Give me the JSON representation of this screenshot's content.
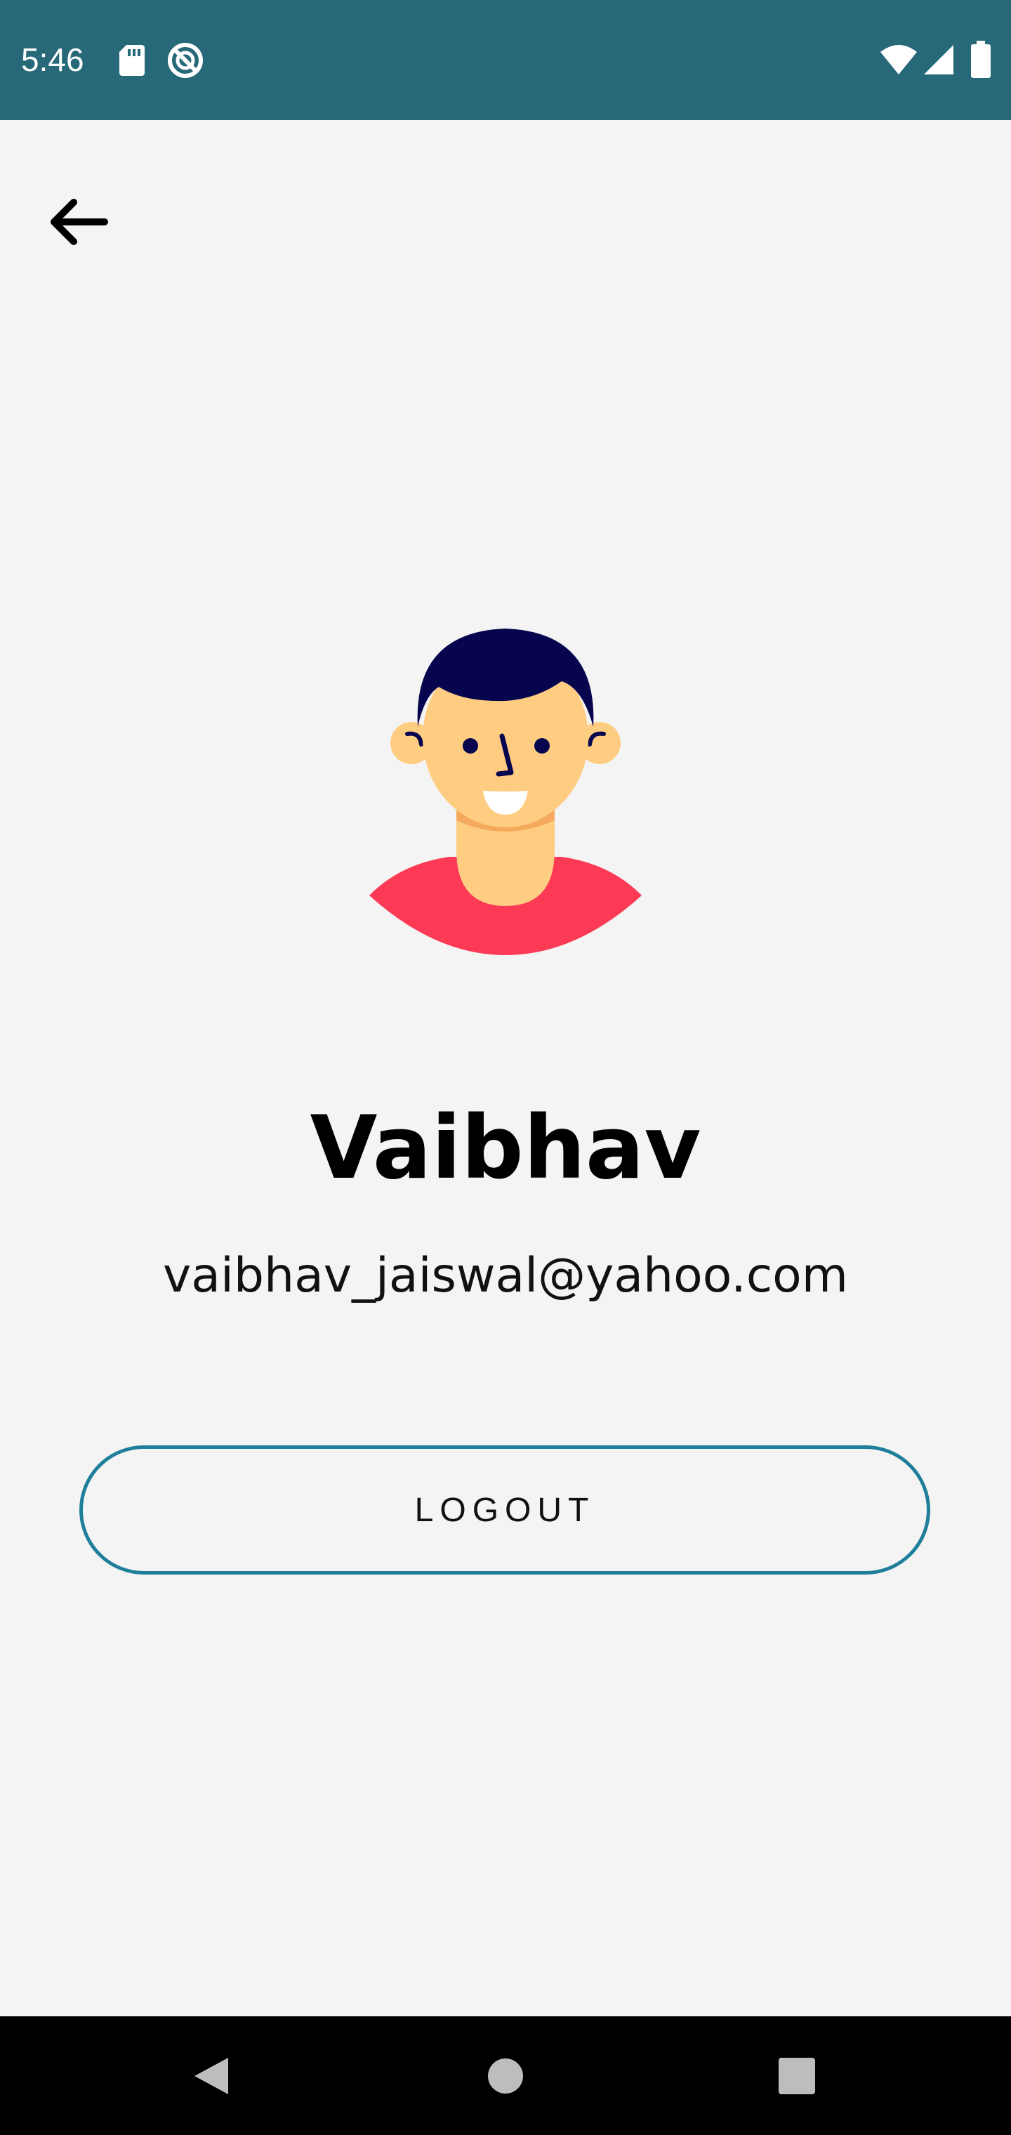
{
  "status_bar": {
    "time": "5:46",
    "icons": [
      "sd-card-icon",
      "sync-disabled-icon",
      "wifi-icon",
      "signal-icon",
      "battery-icon"
    ],
    "background": "#276879"
  },
  "header": {
    "back_icon": "arrow-left-icon"
  },
  "profile": {
    "name": "Vaibhav",
    "email": "vaibhav_jaiswal@yahoo.com",
    "avatar": "avatar-illustration"
  },
  "actions": {
    "logout_label": "LOGOUT",
    "accent_color": "#1f7f9a"
  },
  "nav_bar": {
    "icons": [
      "nav-back-icon",
      "nav-home-icon",
      "nav-recents-icon"
    ]
  }
}
